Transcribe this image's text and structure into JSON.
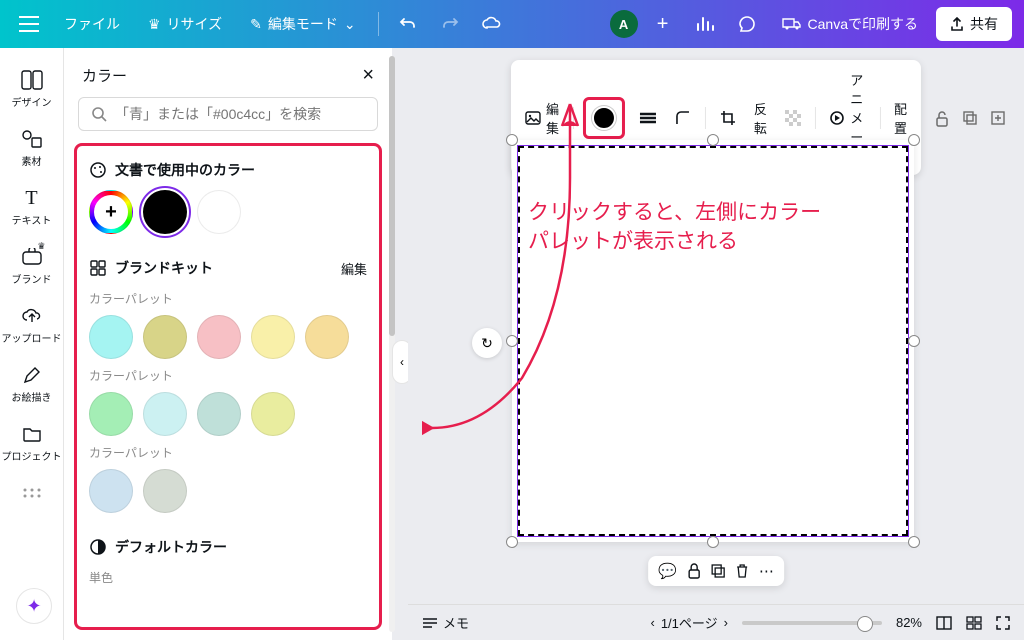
{
  "topbar": {
    "file": "ファイル",
    "resize": "リサイズ",
    "edit_mode": "編集モード",
    "avatar_initial": "A",
    "print": "Canvaで印刷する",
    "share": "共有"
  },
  "rail": {
    "design": "デザイン",
    "elements": "素材",
    "text": "テキスト",
    "brand": "ブランド",
    "upload": "アップロード",
    "draw": "お絵描き",
    "project": "プロジェクト"
  },
  "panel": {
    "title": "カラー",
    "search_placeholder": "「青」または「#00c4cc」を検索",
    "doc_colors": "文書で使用中のカラー",
    "brand_kit": "ブランドキット",
    "edit": "編集",
    "palette_label": "カラーパレット",
    "default_colors": "デフォルトカラー",
    "solid": "単色",
    "palette1": [
      "#a5f4f2",
      "#d8d488",
      "#f7c0c5",
      "#f9f0a9",
      "#f6dd9a"
    ],
    "palette2": [
      "#a4eeb5",
      "#ccf1f2",
      "#bfe0d9",
      "#e9ed9f"
    ],
    "palette3": [
      "#cde2f0",
      "#d5dcd3"
    ]
  },
  "context": {
    "edit": "編集",
    "flip": "反転",
    "animate": "アニメート",
    "position": "配置"
  },
  "annotation": {
    "line1": "クリックすると、左側にカラー",
    "line2": "パレットが表示される"
  },
  "bottom": {
    "memo": "メモ",
    "page": "1/1ページ",
    "zoom": "82%"
  }
}
